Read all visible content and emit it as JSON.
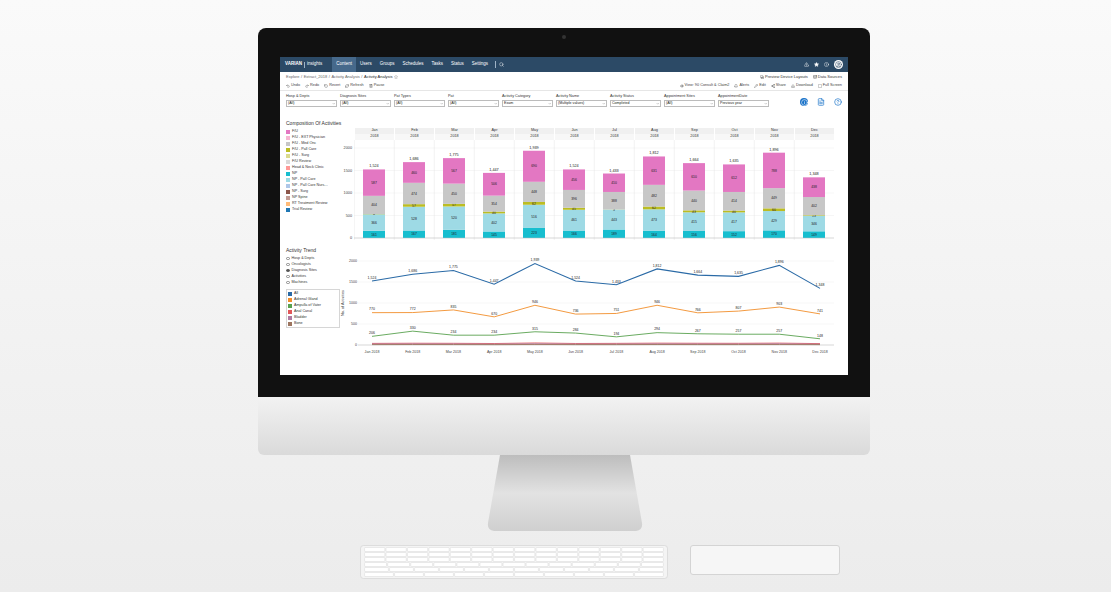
{
  "nav": {
    "brand": "VARIAN",
    "product": "insights",
    "tabs": [
      {
        "label": "Content",
        "selected": true
      },
      {
        "label": "Users",
        "selected": false
      },
      {
        "label": "Groups",
        "selected": false
      },
      {
        "label": "Schedules",
        "selected": false
      },
      {
        "label": "Tasks",
        "selected": false
      },
      {
        "label": "Status",
        "selected": false
      },
      {
        "label": "Settings",
        "selected": false
      }
    ]
  },
  "breadcrumb": {
    "items": [
      "Explore",
      "Extract_2018",
      "Activity Analysis",
      "Activity Analysis"
    ],
    "separator": "/",
    "links": [
      "Preview Device Layouts",
      "Data Sources"
    ]
  },
  "toolbar": {
    "left": [
      "Undo",
      "Redo",
      "Revert",
      "Refresh",
      "Pause"
    ],
    "right": [
      "View: 90 Consult & Claim2",
      "Alerts",
      "Edit",
      "Share",
      "Download",
      "Full Screen"
    ]
  },
  "filters": [
    {
      "label": "Hosp & Depts",
      "value": "(All)"
    },
    {
      "label": "Diagnosis Sites",
      "value": "(All)"
    },
    {
      "label": "Pat Types",
      "value": "(All)"
    },
    {
      "label": "Pat",
      "value": "(All)"
    },
    {
      "label": "Activity Category",
      "value": "Exam"
    },
    {
      "label": "Activity Name",
      "value": "(Multiple values)"
    },
    {
      "label": "Activity Status",
      "value": "Completed"
    },
    {
      "label": "Appointment Sites",
      "value": "(All)"
    },
    {
      "label": "AppointmentDate",
      "value": "Previous year"
    }
  ],
  "bar_chart": {
    "title": "Composition Of Activities",
    "legend": [
      {
        "label": "F/U",
        "color": "#e377c2"
      },
      {
        "label": "F/U - EXT Physician",
        "color": "#f7b6d2"
      },
      {
        "label": "F/U - Med Onc",
        "color": "#c7c7c7"
      },
      {
        "label": "F/U - Pall Care",
        "color": "#bcbd22"
      },
      {
        "label": "F/U - Surg",
        "color": "#dbdb8d"
      },
      {
        "label": "F/U Review",
        "color": "#d9d9d9"
      },
      {
        "label": "Head & Neck Clinic",
        "color": "#ff9896"
      },
      {
        "label": "NP",
        "color": "#17becf"
      },
      {
        "label": "NP - Pall Care",
        "color": "#9edae5"
      },
      {
        "label": "NP - Pall Care Nurs…",
        "color": "#aec7e8"
      },
      {
        "label": "NP - Surg",
        "color": "#8c564b"
      },
      {
        "label": "NP Spine",
        "color": "#c49c94"
      },
      {
        "label": "RT Treatment Review",
        "color": "#ffbb78"
      },
      {
        "label": "Trial Review",
        "color": "#1f77b4"
      }
    ],
    "months": [
      "Jan",
      "Feb",
      "Mar",
      "Apr",
      "May",
      "Jun",
      "Jul",
      "Aug",
      "Sep",
      "Oct",
      "Nov",
      "Dec"
    ],
    "year": "2018",
    "y_ticks": [
      "2000",
      "1500",
      "1000",
      "500",
      "0"
    ],
    "total_labels": [
      "1,524",
      "1,686",
      "1,775",
      "1,447",
      "1,939",
      "1,524",
      "1,433",
      "1,812",
      "1,664",
      "1,635",
      "1,896",
      "1,348"
    ],
    "series": [
      {
        "name": "NP",
        "color": "#17becf",
        "values": [
          161,
          167,
          181,
          145,
          223,
          166,
          189,
          164,
          156,
          152,
          170,
          149
        ],
        "labels": [
          "161",
          "167",
          "181",
          "145",
          "223",
          "166",
          "189",
          "164",
          "156",
          "152",
          "170",
          "149"
        ]
      },
      {
        "name": "NP - Pall Care",
        "color": "#9edae5",
        "values": [
          366,
          528,
          520,
          402,
          516,
          461,
          443,
          473,
          415,
          417,
          429,
          346
        ],
        "labels": [
          "366",
          "528",
          "520",
          "402",
          "516",
          "461",
          "443",
          "473",
          "415",
          "417",
          "429",
          "346"
        ]
      },
      {
        "name": "F/U - Pall Care",
        "color": "#bcbd22",
        "values": [
          6,
          57,
          57,
          40,
          62,
          45,
          3,
          62,
          43,
          40,
          60,
          13
        ],
        "labels": [
          "6",
          "57",
          "57",
          "40",
          "62",
          "45",
          "3",
          "62",
          "43",
          "40",
          "60",
          "13"
        ]
      },
      {
        "name": "F/U - Med Onc",
        "color": "#c7c7c7",
        "values": [
          404,
          474,
          450,
          354,
          448,
          396,
          388,
          482,
          440,
          414,
          449,
          402
        ],
        "labels": [
          "404",
          "474",
          "450",
          "354",
          "448",
          "396",
          "388",
          "482",
          "440",
          "414",
          "449",
          "402"
        ]
      },
      {
        "name": "F/U",
        "color": "#e377c2",
        "values": [
          587,
          460,
          567,
          506,
          690,
          456,
          410,
          631,
          610,
          612,
          788,
          438
        ],
        "labels": [
          "587",
          "460",
          "567",
          "506",
          "690",
          "456",
          "410",
          "631",
          "610",
          "612",
          "788",
          "438"
        ]
      }
    ]
  },
  "trend_chart": {
    "title": "Activity Trend",
    "axis_title": "No. of Activities",
    "y_ticks": [
      "2000",
      "1500",
      "1000",
      "500",
      "0"
    ],
    "x_labels": [
      "Jan 2018",
      "Feb 2018",
      "Mar 2018",
      "Apr 2018",
      "May 2018",
      "Jun 2018",
      "Jul 2018",
      "Aug 2018",
      "Sep 2018",
      "Oct 2018",
      "Nov 2018",
      "Dec 2018"
    ],
    "view_options": [
      {
        "label": "Hosp & Depts",
        "selected": false
      },
      {
        "label": "Oncologists",
        "selected": false
      },
      {
        "label": "Diagnosis Sites",
        "selected": true
      },
      {
        "label": "Activities",
        "selected": false
      },
      {
        "label": "Machines",
        "selected": false
      }
    ],
    "series": [
      {
        "name": "All",
        "color": "#2a6aa6",
        "values": [
          1524,
          1686,
          1775,
          1447,
          1939,
          1524,
          1433,
          1812,
          1664,
          1635,
          1896,
          1348
        ],
        "labels": [
          "1,524",
          "1,686",
          "1,775",
          "1,447",
          "1,939",
          "1,524",
          "1,433",
          "1,812",
          "1,664",
          "1,635",
          "1,896",
          "1,348"
        ]
      },
      {
        "name": "Adrenal Gland",
        "color": "#f28e2b",
        "values": [
          770,
          772,
          835,
          670,
          946,
          736,
          751,
          946,
          766,
          807,
          903,
          741
        ],
        "labels": [
          "770",
          "772",
          "835",
          "670",
          "946",
          "736",
          "751",
          "946",
          "766",
          "807",
          "903",
          "741"
        ]
      },
      {
        "name": "Ampulla of Vater",
        "color": "#59a14f",
        "values": [
          206,
          330,
          234,
          234,
          315,
          284,
          194,
          294,
          267,
          257,
          257,
          148
        ],
        "labels": [
          "206",
          "330",
          "234",
          "234",
          "315",
          "284",
          "194",
          "294",
          "267",
          "257",
          "257",
          "148"
        ]
      },
      {
        "name": "Anal Canal",
        "color": "#e15759",
        "values": [
          38,
          42,
          40,
          35,
          48,
          36,
          39,
          44,
          41,
          40,
          45,
          33
        ],
        "labels": []
      },
      {
        "name": "Bladder",
        "color": "#b07aa1",
        "values": [
          24,
          26,
          25,
          21,
          29,
          22,
          23,
          27,
          25,
          24,
          28,
          20
        ],
        "labels": []
      },
      {
        "name": "Bone",
        "color": "#9c755f",
        "values": [
          10,
          12,
          11,
          9,
          13,
          10,
          10,
          12,
          11,
          11,
          12,
          9
        ],
        "labels": []
      }
    ]
  }
}
